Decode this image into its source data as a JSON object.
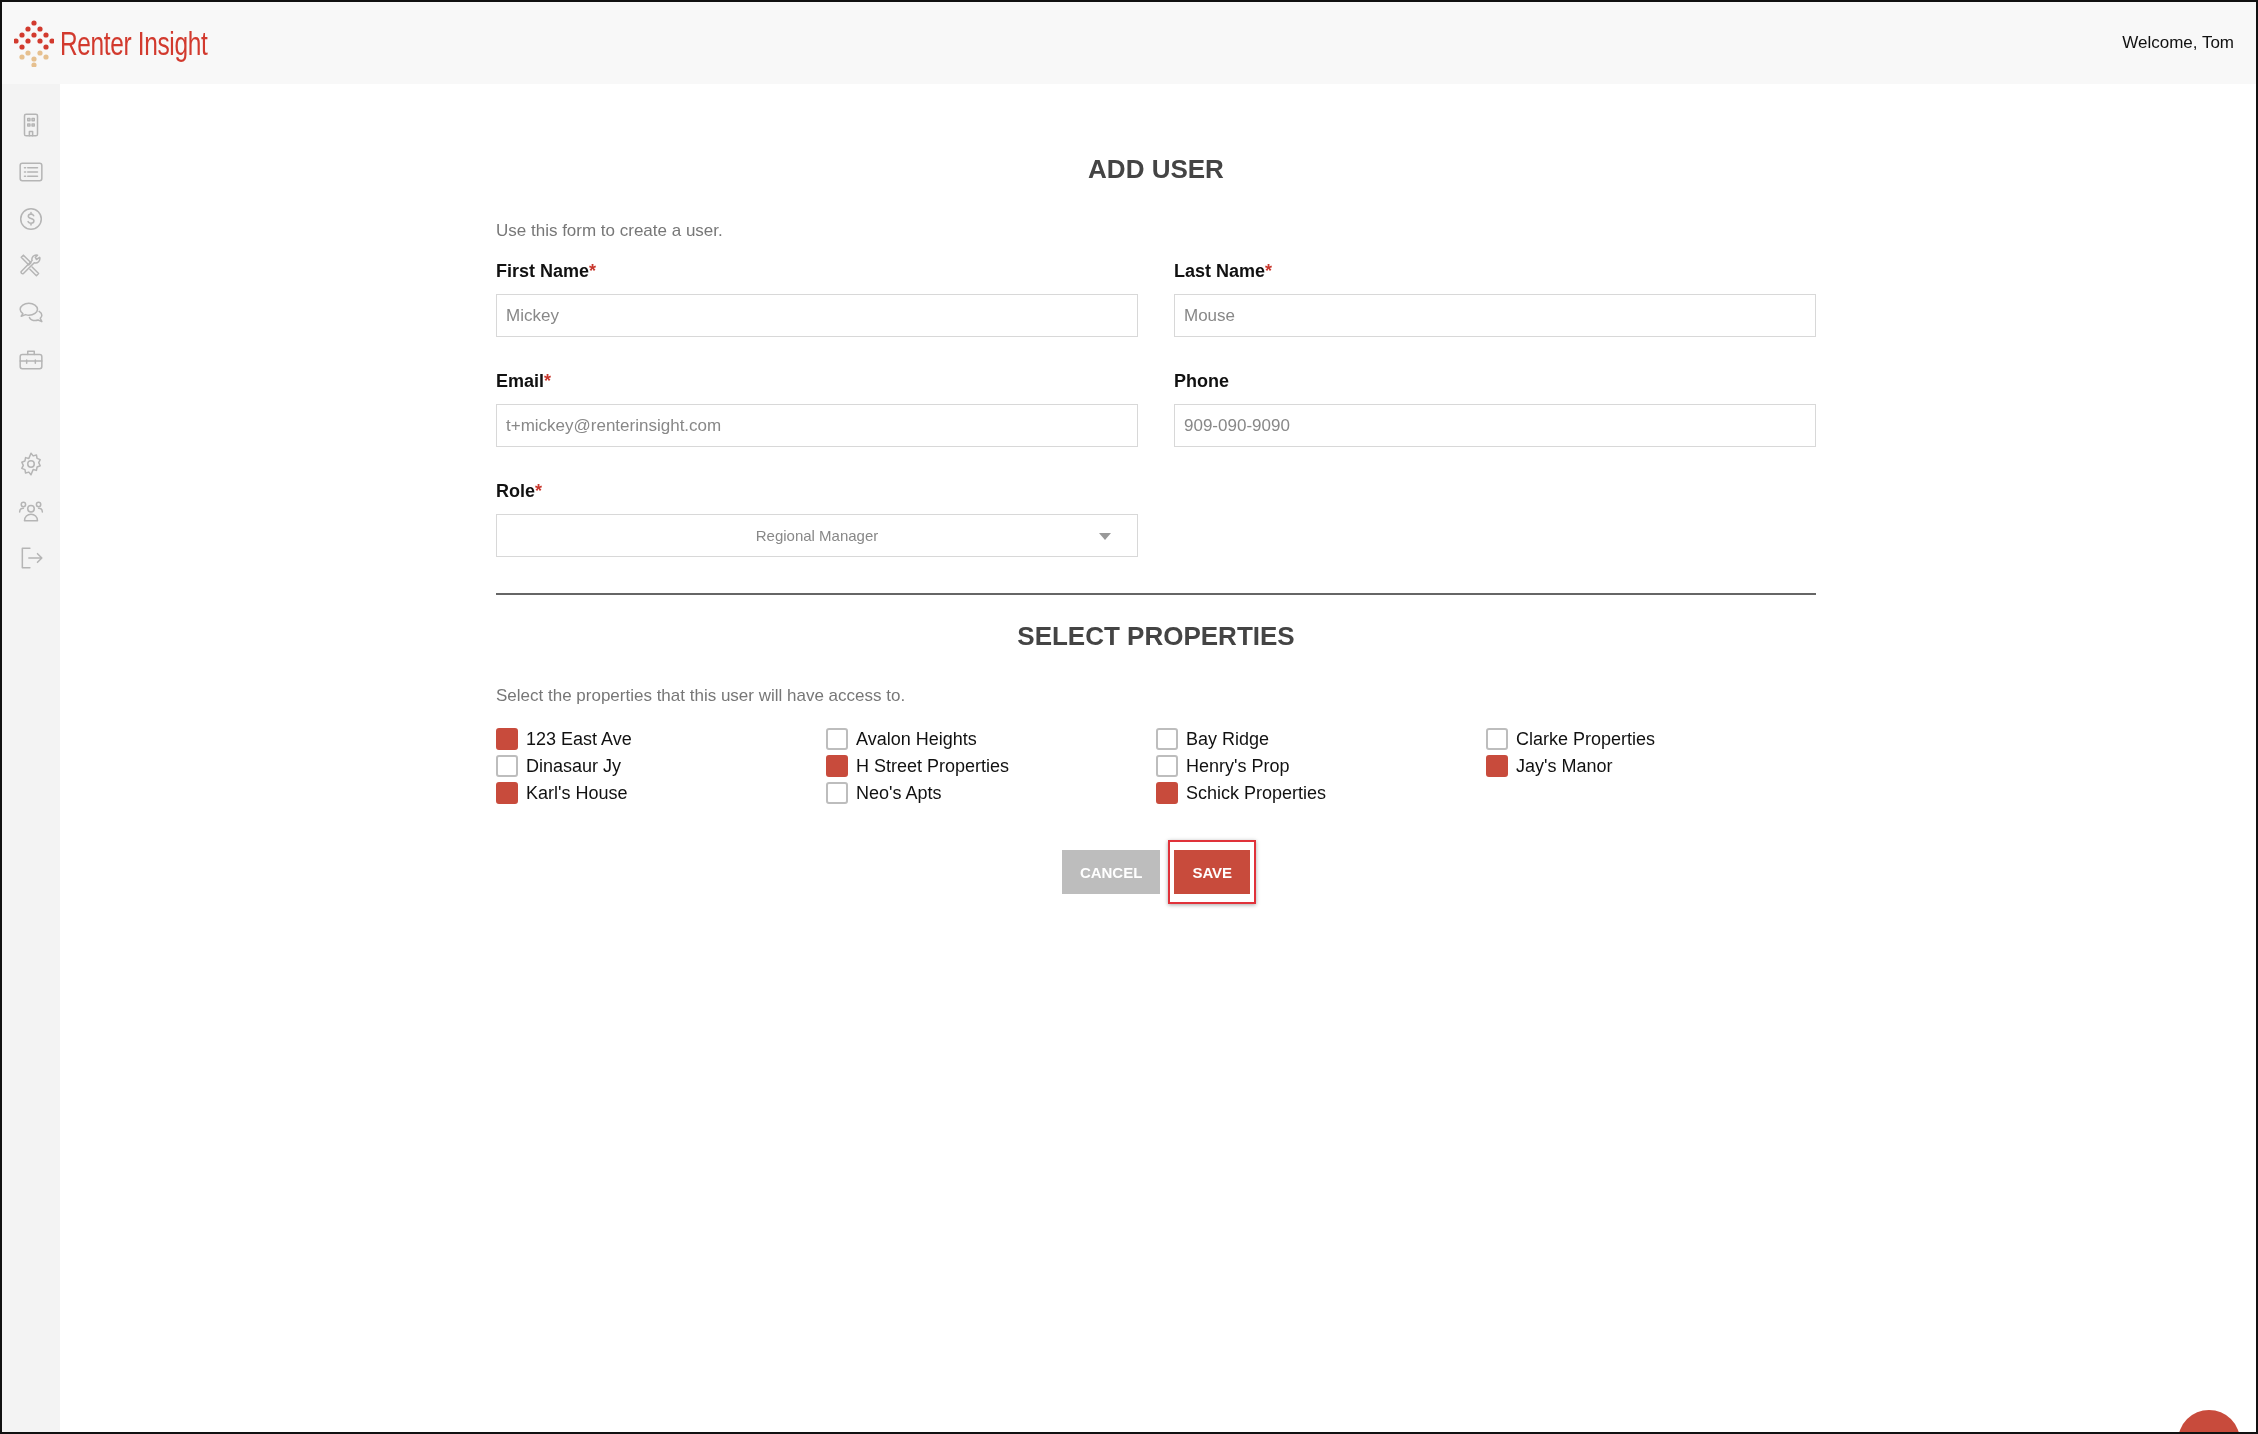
{
  "header": {
    "brand": "Renter Insight",
    "welcome": "Welcome, Tom"
  },
  "sidebar": {
    "items": [
      {
        "kind": "building"
      },
      {
        "kind": "list"
      },
      {
        "kind": "dollar"
      },
      {
        "kind": "tools"
      },
      {
        "kind": "chat"
      },
      {
        "kind": "briefcase"
      },
      {
        "kind": "gap"
      },
      {
        "kind": "gear"
      },
      {
        "kind": "users"
      },
      {
        "kind": "logout"
      }
    ]
  },
  "form": {
    "title": "ADD USER",
    "intro": "Use this form to create a user.",
    "fields": [
      {
        "label": "First Name",
        "required_mark": "*",
        "value": "Mickey",
        "kind": "text"
      },
      {
        "label": "Last Name",
        "required_mark": "*",
        "value": "Mouse",
        "kind": "text"
      },
      {
        "label": "Email",
        "required_mark": "*",
        "value": "t+mickey@renterinsight.com",
        "kind": "text"
      },
      {
        "label": "Phone",
        "value": "909-090-9090",
        "kind": "text"
      },
      {
        "label": "Role",
        "required_mark": "*",
        "value": "Regional Manager",
        "kind": "select"
      }
    ]
  },
  "properties": {
    "title": "SELECT PROPERTIES",
    "intro": "Select the properties that this user will have access to.",
    "items": [
      {
        "label": "123 East Ave",
        "checked": true
      },
      {
        "label": "Avalon Heights",
        "checked": false
      },
      {
        "label": "Bay Ridge",
        "checked": false
      },
      {
        "label": "Clarke Properties",
        "checked": false
      },
      {
        "label": "Dinasaur Jy",
        "checked": false
      },
      {
        "label": "H Street Properties",
        "checked": true
      },
      {
        "label": "Henry's Prop",
        "checked": false
      },
      {
        "label": "Jay's Manor",
        "checked": true
      },
      {
        "label": "Karl's House",
        "checked": true
      },
      {
        "label": "Neo's Apts",
        "checked": false
      },
      {
        "label": "Schick Properties",
        "checked": true
      }
    ]
  },
  "buttons": [
    {
      "label": "CANCEL",
      "kind": "secondary",
      "highlighted": false
    },
    {
      "label": "SAVE",
      "kind": "primary",
      "highlighted": true
    }
  ]
}
